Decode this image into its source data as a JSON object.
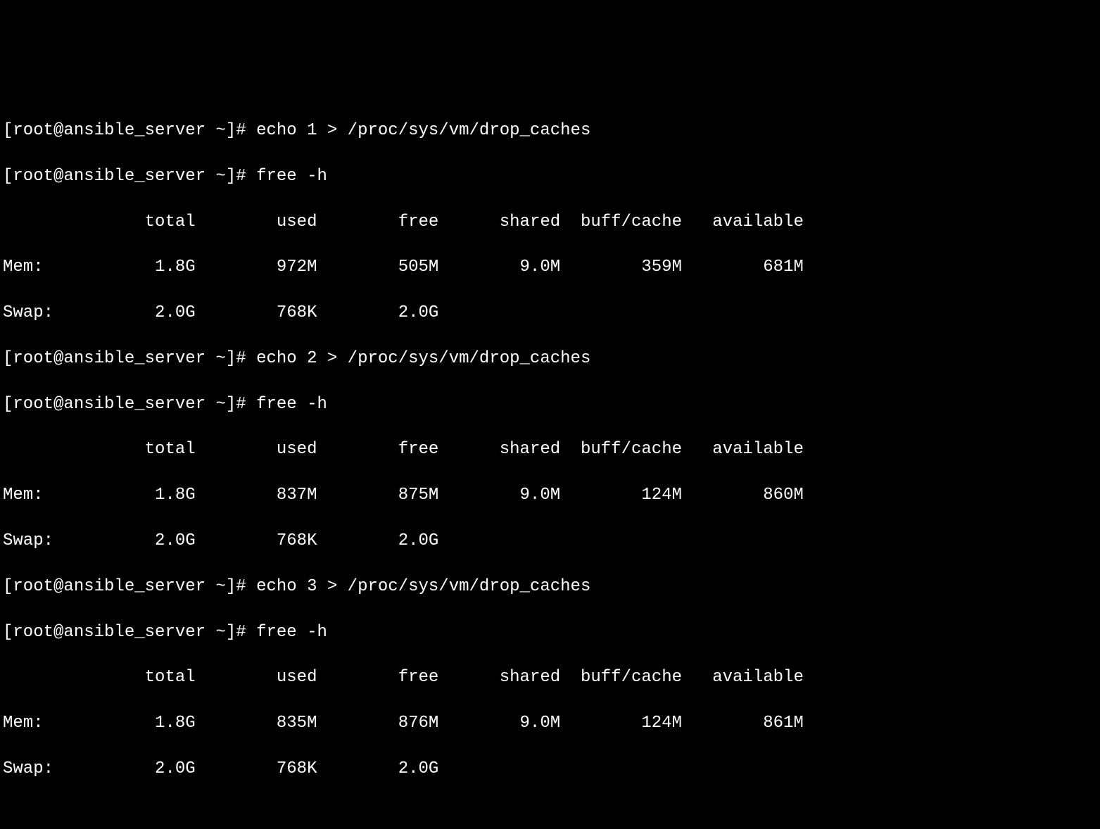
{
  "prompt": "[root@ansible_server ~]# ",
  "commands": {
    "echo1": "echo 1 > /proc/sys/vm/drop_caches",
    "echo2": "echo 2 > /proc/sys/vm/drop_caches",
    "echo3": "echo 3 > /proc/sys/vm/drop_caches",
    "free": "free -h"
  },
  "headers": {
    "total": "total",
    "used": "used",
    "free": "free",
    "shared": "shared",
    "buffcache": "buff/cache",
    "available": "available"
  },
  "labels": {
    "mem": "Mem:",
    "swap": "Swap:"
  },
  "block1": {
    "mem": {
      "total": "1.8G",
      "used": "972M",
      "free": "505M",
      "shared": "9.0M",
      "buffcache": "359M",
      "available": "681M"
    },
    "swap": {
      "total": "2.0G",
      "used": "768K",
      "free": "2.0G"
    }
  },
  "block2": {
    "mem": {
      "total": "1.8G",
      "used": "837M",
      "free": "875M",
      "shared": "9.0M",
      "buffcache": "124M",
      "available": "860M"
    },
    "swap": {
      "total": "2.0G",
      "used": "768K",
      "free": "2.0G"
    }
  },
  "block3": {
    "mem": {
      "total": "1.8G",
      "used": "835M",
      "free": "876M",
      "shared": "9.0M",
      "buffcache": "124M",
      "available": "861M"
    },
    "swap": {
      "total": "2.0G",
      "used": "768K",
      "free": "2.0G"
    }
  }
}
